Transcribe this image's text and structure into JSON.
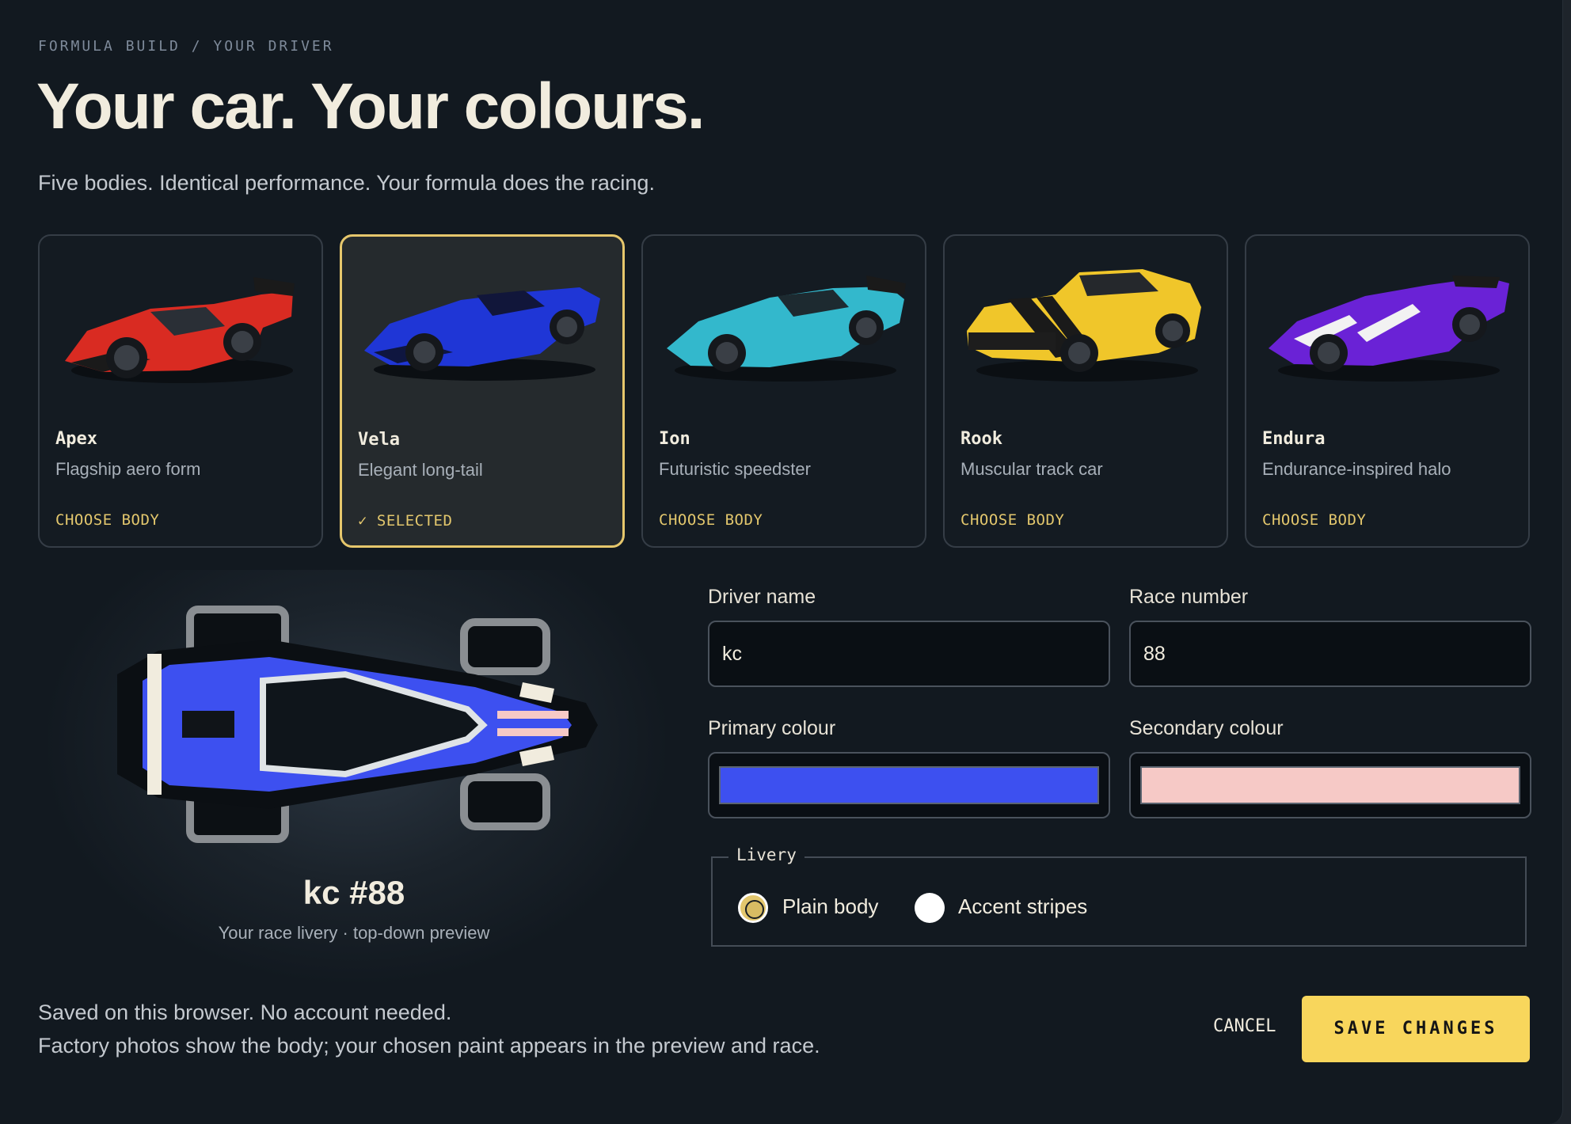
{
  "breadcrumb": "FORMULA BUILD / YOUR DRIVER",
  "title": "Your car. Your colours.",
  "subtitle": "Five bodies. Identical performance. Your formula does the racing.",
  "bodies": [
    {
      "name": "Apex",
      "description": "Flagship aero form",
      "action": "CHOOSE BODY",
      "color": "#d92b22",
      "selected": false
    },
    {
      "name": "Vela",
      "description": "Elegant long-tail",
      "action": "✓ SELECTED",
      "color": "#1f36d6",
      "selected": true
    },
    {
      "name": "Ion",
      "description": "Futuristic speedster",
      "action": "CHOOSE BODY",
      "color": "#33b8cc",
      "selected": false
    },
    {
      "name": "Rook",
      "description": "Muscular track car",
      "action": "CHOOSE BODY",
      "color": "#f0c62a",
      "selected": false
    },
    {
      "name": "Endura",
      "description": "Endurance-inspired halo",
      "action": "CHOOSE BODY",
      "color": "#6a22d6",
      "selected": false
    }
  ],
  "preview": {
    "name": "kc #88",
    "caption": "Your race livery · top-down preview"
  },
  "form": {
    "driver_name_label": "Driver name",
    "driver_name_value": "kc",
    "race_number_label": "Race number",
    "race_number_value": "88",
    "primary_colour_label": "Primary colour",
    "primary_colour_value": "#3d50f0",
    "secondary_colour_label": "Secondary colour",
    "secondary_colour_value": "#f6c9c6",
    "livery_legend": "Livery",
    "livery_options": [
      "Plain body",
      "Accent stripes"
    ],
    "livery_selected": "Plain body"
  },
  "footer": {
    "line1": "Saved on this browser. No account needed.",
    "line2": "Factory photos show the body; your chosen paint appears in the preview and race.",
    "cancel_label": "CANCEL",
    "save_label": "SAVE CHANGES"
  },
  "colors": {
    "accent": "#f8d65c",
    "selected_border": "#e6c76c"
  }
}
